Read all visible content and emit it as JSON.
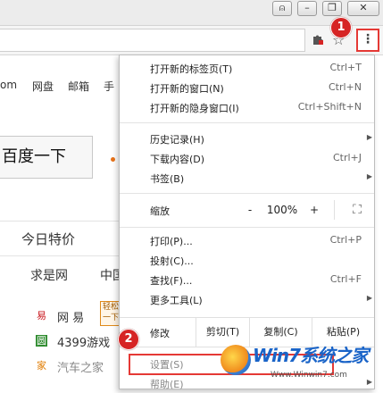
{
  "window": {
    "buttons": [
      {
        "name": "user-icon",
        "glyph": "⍝"
      },
      {
        "name": "minimize-icon",
        "glyph": "–"
      },
      {
        "name": "restore-icon",
        "glyph": "❐"
      },
      {
        "name": "close-icon",
        "glyph": "✕"
      }
    ]
  },
  "toolbar": {
    "extension_icon": "puzzle-icon",
    "star_icon": "star-icon",
    "menu_glyph": "⋮"
  },
  "badges": [
    "1",
    "2"
  ],
  "page": {
    "nav": [
      "om",
      "网盘",
      "邮箱",
      "手"
    ],
    "search_button": "百度一下",
    "today_tab": "今日特价",
    "sites": [
      "求是网",
      "中国"
    ],
    "list": [
      {
        "icon": "易",
        "label": "网  易",
        "color": "#c8161d"
      },
      {
        "icon": "圆",
        "label": "4399游戏",
        "color": "#2e8b2e"
      },
      {
        "icon": "家",
        "label": "汽车之家",
        "color": "#e07b00"
      }
    ],
    "orange_label": "轻松一下"
  },
  "menu": {
    "group1": [
      {
        "label": "打开新的标签页(T)",
        "shortcut": "Ctrl+T"
      },
      {
        "label": "打开新的窗口(N)",
        "shortcut": "Ctrl+N"
      },
      {
        "label": "打开新的隐身窗口(I)",
        "shortcut": "Ctrl+Shift+N"
      }
    ],
    "group2": [
      {
        "label": "历史记录(H)",
        "shortcut": "",
        "arrow": "▶"
      },
      {
        "label": "下载内容(D)",
        "shortcut": "Ctrl+J"
      },
      {
        "label": "书签(B)",
        "shortcut": "",
        "arrow": "▶"
      }
    ],
    "zoom": {
      "label": "缩放",
      "minus": "-",
      "value": "100%",
      "plus": "+",
      "fullscreen": "⛶"
    },
    "group3": [
      {
        "label": "打印(P)...",
        "shortcut": "Ctrl+P"
      },
      {
        "label": "投射(C)...",
        "shortcut": ""
      },
      {
        "label": "查找(F)...",
        "shortcut": "Ctrl+F"
      },
      {
        "label": "更多工具(L)",
        "shortcut": "",
        "arrow": "▶"
      }
    ],
    "edit": {
      "label": "修改",
      "cut": "剪切(T)",
      "copy": "复制(C)",
      "paste": "粘贴(P)"
    },
    "group4": [
      {
        "label": "设置(S)",
        "shortcut": ""
      },
      {
        "label": "帮助(E)",
        "shortcut": "",
        "arrow": "▶"
      }
    ]
  },
  "watermark": {
    "text": "Win7系统之家",
    "url": "Www.Winwin7.com"
  }
}
